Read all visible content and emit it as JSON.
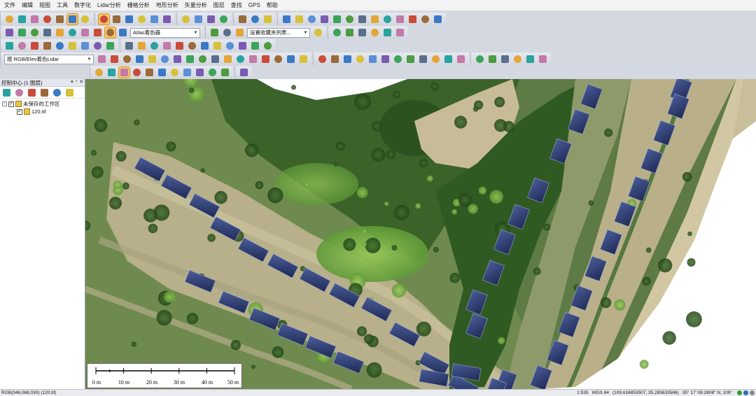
{
  "menu": [
    "文件",
    "编辑",
    "视图",
    "工具",
    "数字化",
    "Lidar分析",
    "栅格分析",
    "地形分析",
    "矢量分析",
    "图层",
    "查找",
    "GPS",
    "帮助"
  ],
  "toolbar": {
    "shader_dropdown": "Atlas着色器",
    "favorites_dropdown": "设置收藏夹列表...",
    "lidar_color_dropdown": "按 RGB/Elev着色Lidar"
  },
  "panel": {
    "title": "控制中心 (1 图层)",
    "workspace_label": "未保存的工作区",
    "layer_label": "120.tif"
  },
  "scalebar": {
    "labels": [
      "0 m",
      "10 m",
      "20 m",
      "30 m",
      "40 m",
      "50 m"
    ]
  },
  "status": {
    "pixel_value": "RGB(046,068,030) (120.tif)",
    "scale": "1:535",
    "crs": "WGS 84",
    "coords": "(109.616853507, 35.285633566)",
    "dms": "35° 17' 08.2808\" N, 109°"
  },
  "colors": {
    "toolbar_bg": "#d4d8e0",
    "active_tool": "#f7c56b",
    "vegetation_dark": "#2f5a22",
    "vegetation_light": "#7fb24a",
    "soil": "#c9bf9d",
    "solar_panel": "#2d3a6e"
  }
}
